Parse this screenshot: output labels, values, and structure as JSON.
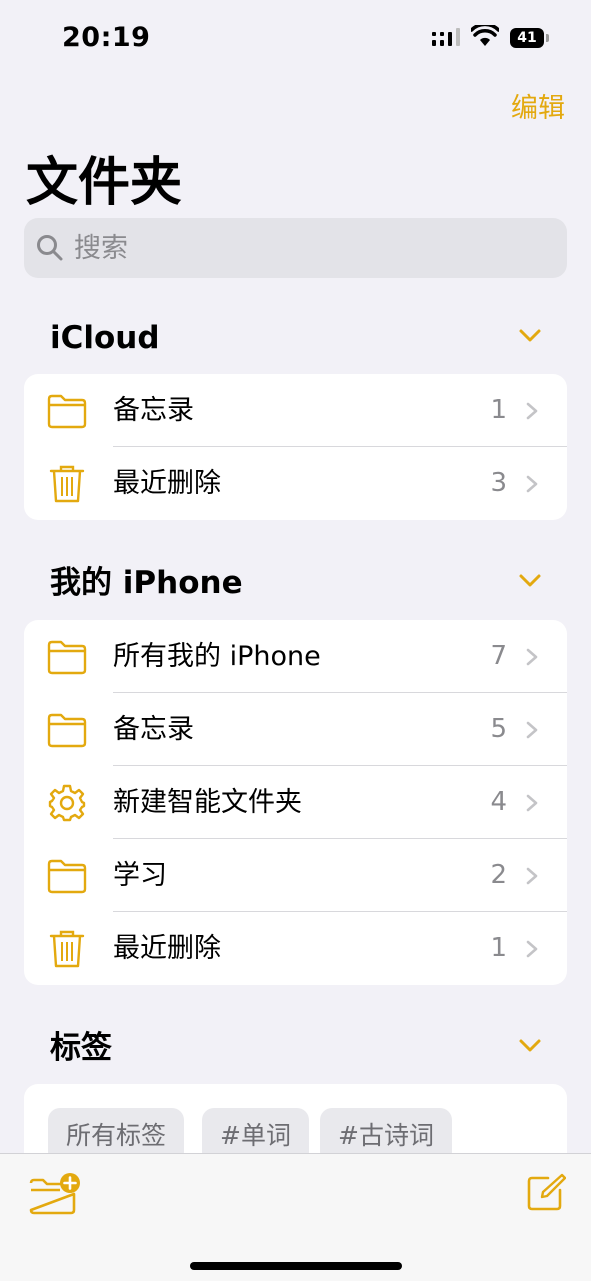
{
  "status_bar": {
    "time": "20:19",
    "battery": "41"
  },
  "header": {
    "edit_label": "编辑",
    "title": "文件夹"
  },
  "search": {
    "placeholder": "搜索"
  },
  "icloud": {
    "title": "iCloud",
    "folders": [
      {
        "icon": "folder-icon",
        "label": "备忘录",
        "count": "1"
      },
      {
        "icon": "trash-icon",
        "label": "最近删除",
        "count": "3"
      }
    ]
  },
  "iphone": {
    "title": "我的 iPhone",
    "folders": [
      {
        "icon": "folder-icon",
        "label": "所有我的 iPhone",
        "count": "7"
      },
      {
        "icon": "folder-icon",
        "label": "备忘录",
        "count": "5"
      },
      {
        "icon": "gear-icon",
        "label": "新建智能文件夹",
        "count": "4"
      },
      {
        "icon": "folder-icon",
        "label": "学习",
        "count": "2"
      },
      {
        "icon": "trash-icon",
        "label": "最近删除",
        "count": "1"
      }
    ]
  },
  "tags": {
    "title": "标签",
    "chips": [
      "所有标签",
      "#单词",
      "#古诗词"
    ]
  },
  "colors": {
    "accent": "#e3a90f",
    "background": "#f2f1f7",
    "count_gray": "#8a8a8e"
  }
}
